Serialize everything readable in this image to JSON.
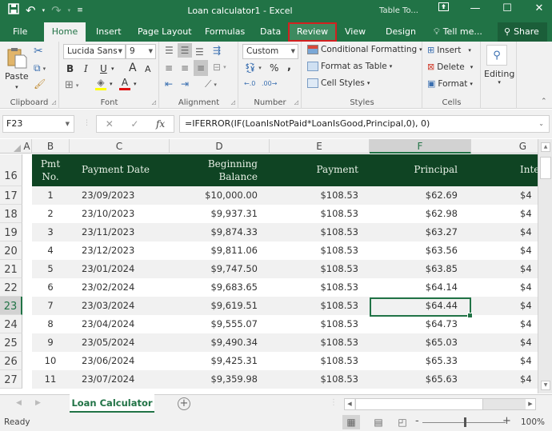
{
  "titlebar": {
    "title": "Loan calculator1 - Excel",
    "context_tab": "Table To...",
    "qat": {
      "save": "save-icon",
      "undo": "undo-icon",
      "redo": "redo-icon",
      "customize": "customize-qat-icon"
    },
    "window_buttons": {
      "ribbon_display": "ribbon-display-icon",
      "minimize": "—",
      "maximize": "☐",
      "close": "✕"
    }
  },
  "tabs": [
    "File",
    "Home",
    "Insert",
    "Page Layout",
    "Formulas",
    "Data",
    "Review",
    "View",
    "Design"
  ],
  "active_tab": "Home",
  "highlighted_tab": "Review",
  "tell_me": "Tell me...",
  "share": "Share",
  "ribbon": {
    "clipboard": {
      "label": "Clipboard",
      "paste": "Paste"
    },
    "font": {
      "label": "Font",
      "font_name": "Lucida Sans",
      "font_size": "9",
      "bold": "B",
      "italic": "I",
      "underline": "U",
      "grow": "A",
      "shrink": "A",
      "fill_color": "#ffff00",
      "font_color": "#e01010"
    },
    "alignment": {
      "label": "Alignment"
    },
    "number": {
      "label": "Number",
      "format": "Custom",
      "percent": "%",
      "comma": ",",
      "inc_dec": "←.0 .00",
      "dec_dec": ".00 →.0"
    },
    "styles": {
      "label": "Styles",
      "conditional": "Conditional Formatting",
      "format_table": "Format as Table",
      "cell_styles": "Cell Styles"
    },
    "cells": {
      "label": "Cells",
      "insert": "Insert",
      "delete": "Delete",
      "format": "Format"
    },
    "editing": {
      "label": "Editing"
    }
  },
  "formula_bar": {
    "name_box": "F23",
    "cancel": "✕",
    "enter": "✓",
    "fx": "fx",
    "formula": "=IFERROR(IF(LoanIsNotPaid*LoanIsGood,Principal,0), 0)"
  },
  "columns": [
    "A",
    "B",
    "C",
    "D",
    "E",
    "F",
    "G"
  ],
  "selected_column": "F",
  "row_numbers": [
    "16",
    "17",
    "18",
    "19",
    "20",
    "21",
    "22",
    "23",
    "24",
    "25",
    "26",
    "27"
  ],
  "selected_row": "23",
  "table": {
    "headers": {
      "pmt_no_1": "Pmt",
      "pmt_no_2": "No.",
      "payment_date": "Payment Date",
      "beginning_1": "Beginning",
      "beginning_2": "Balance",
      "payment": "Payment",
      "principal": "Principal",
      "interest": "Inte"
    },
    "rows": [
      {
        "no": "1",
        "date": "23/09/2023",
        "balance": "$10,000.00",
        "payment": "$108.53",
        "principal": "$62.69",
        "interest": "$4"
      },
      {
        "no": "2",
        "date": "23/10/2023",
        "balance": "$9,937.31",
        "payment": "$108.53",
        "principal": "$62.98",
        "interest": "$4"
      },
      {
        "no": "3",
        "date": "23/11/2023",
        "balance": "$9,874.33",
        "payment": "$108.53",
        "principal": "$63.27",
        "interest": "$4"
      },
      {
        "no": "4",
        "date": "23/12/2023",
        "balance": "$9,811.06",
        "payment": "$108.53",
        "principal": "$63.56",
        "interest": "$4"
      },
      {
        "no": "5",
        "date": "23/01/2024",
        "balance": "$9,747.50",
        "payment": "$108.53",
        "principal": "$63.85",
        "interest": "$4"
      },
      {
        "no": "6",
        "date": "23/02/2024",
        "balance": "$9,683.65",
        "payment": "$108.53",
        "principal": "$64.14",
        "interest": "$4"
      },
      {
        "no": "7",
        "date": "23/03/2024",
        "balance": "$9,619.51",
        "payment": "$108.53",
        "principal": "$64.44",
        "interest": "$4"
      },
      {
        "no": "8",
        "date": "23/04/2024",
        "balance": "$9,555.07",
        "payment": "$108.53",
        "principal": "$64.73",
        "interest": "$4"
      },
      {
        "no": "9",
        "date": "23/05/2024",
        "balance": "$9,490.34",
        "payment": "$108.53",
        "principal": "$65.03",
        "interest": "$4"
      },
      {
        "no": "10",
        "date": "23/06/2024",
        "balance": "$9,425.31",
        "payment": "$108.53",
        "principal": "$65.33",
        "interest": "$4"
      },
      {
        "no": "11",
        "date": "23/07/2024",
        "balance": "$9,359.98",
        "payment": "$108.53",
        "principal": "$65.63",
        "interest": "$4"
      }
    ]
  },
  "sheet_tabs": [
    "Loan Calculator"
  ],
  "status": {
    "ready": "Ready",
    "zoom": "100%"
  },
  "colors": {
    "excel_green": "#217346",
    "table_header": "#0f4423",
    "highlight_border": "#d32020"
  }
}
